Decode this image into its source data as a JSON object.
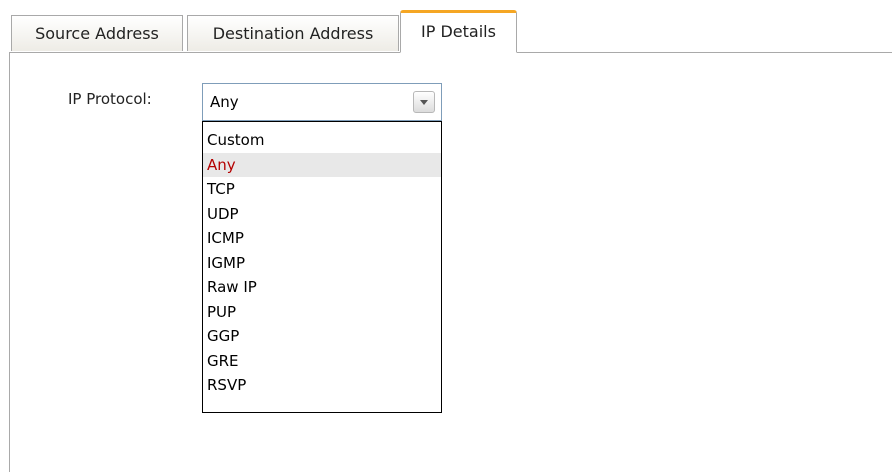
{
  "tabs": [
    {
      "label": "Source Address",
      "active": false
    },
    {
      "label": "Destination Address",
      "active": false
    },
    {
      "label": "IP Details",
      "active": true
    }
  ],
  "ip_protocol": {
    "label": "IP Protocol:",
    "selected_value": "Any",
    "options": [
      "Custom",
      "Any",
      "TCP",
      "UDP",
      "ICMP",
      "IGMP",
      "Raw IP",
      "PUP",
      "GGP",
      "GRE",
      "RSVP"
    ],
    "highlighted_option": "Any"
  },
  "colors": {
    "active_tab_accent": "#f5a623",
    "highlighted_option_text": "#b40000",
    "highlighted_option_bg": "#e8e8e8"
  },
  "icons": {
    "dropdown_button": "chevron-down-icon"
  }
}
